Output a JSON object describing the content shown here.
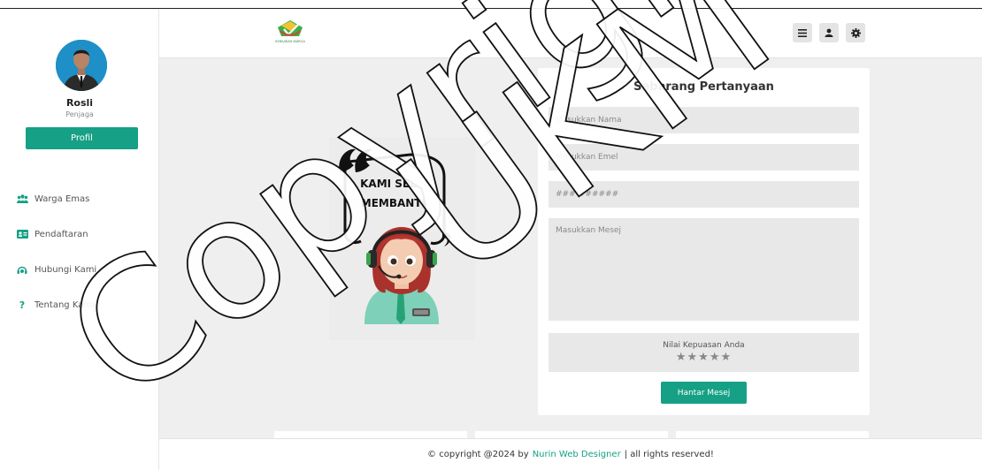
{
  "sidebar": {
    "user_name": "Rosli",
    "user_role": "Penjaga",
    "profile_button": "Profil",
    "items": [
      {
        "label": "Warga Emas",
        "icon": "users-icon"
      },
      {
        "label": "Pendaftaran",
        "icon": "id-card-icon"
      },
      {
        "label": "Hubungi Kami",
        "icon": "headset-icon"
      },
      {
        "label": "Tentang Kami",
        "icon": "question-icon"
      }
    ]
  },
  "header": {
    "logo_text": "KEBAJIKAN WARGA",
    "buttons": [
      "menu-icon",
      "user-icon",
      "gear-icon"
    ]
  },
  "illustration": {
    "line1": "KAMI SEDIA",
    "line2": "MEMBANTU"
  },
  "form": {
    "title": "Sebarang Pertanyaan",
    "name_placeholder": "Masukkan Nama",
    "email_placeholder": "Masukkan Emel",
    "phone_placeholder": "###-######",
    "message_placeholder": "Masukkan Mesej",
    "rating_label": "Nilai Kepuasan Anda",
    "stars": "★★★★★",
    "rating_value": 0,
    "submit_label": "Hantar Mesej"
  },
  "footer": {
    "prefix": "© copyright @2024 by",
    "link": "Nurin Web Designer",
    "suffix": "| all rights reserved!"
  },
  "watermark": {
    "text1": "Copyright©",
    "text2": "UKM"
  },
  "colors": {
    "accent": "#16a085",
    "background": "#efefef"
  }
}
